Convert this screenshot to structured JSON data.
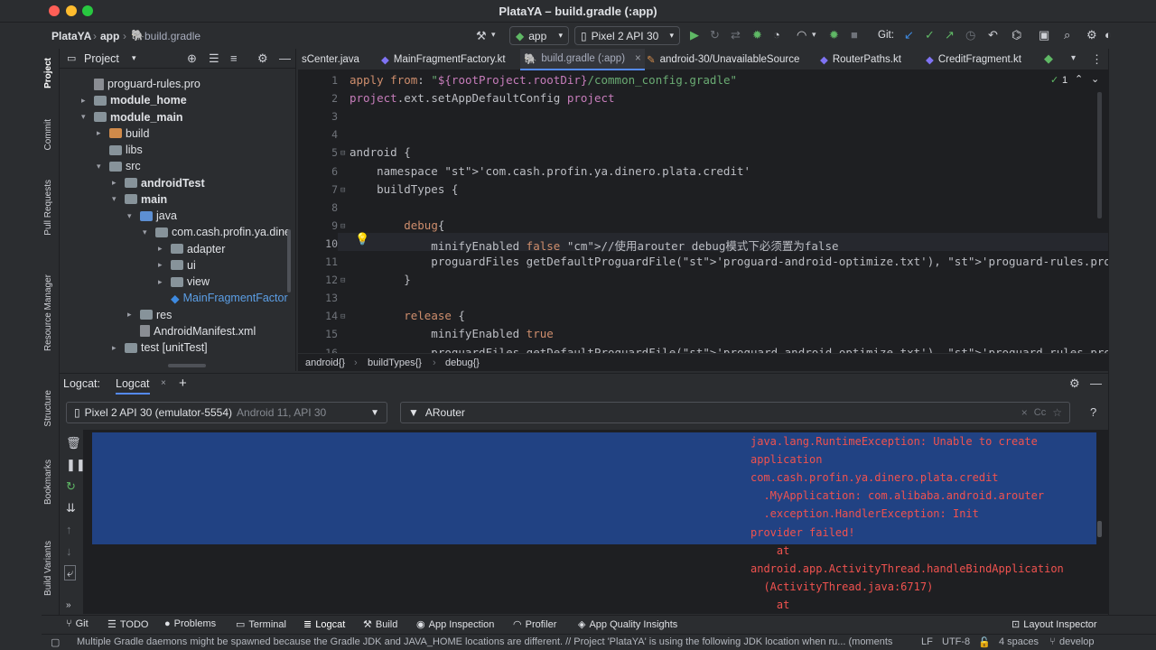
{
  "window": {
    "title": "PlataYA – build.gradle (:app)"
  },
  "nav": {
    "project": "PlataYA",
    "module": "app",
    "file": "build.gradle"
  },
  "toolbar": {
    "run_config": "app",
    "device": "Pixel 2 API 30",
    "git_label": "Git:"
  },
  "project_panel": {
    "title": "Project",
    "tree": [
      {
        "label": "proguard-rules.pro",
        "kind": "file",
        "indent": 0
      },
      {
        "label": "module_home",
        "kind": "folder",
        "indent": 0,
        "bold": true
      },
      {
        "label": "module_main",
        "kind": "folder",
        "indent": 0,
        "bold": true
      },
      {
        "label": "build",
        "kind": "folder-orange",
        "indent": 1
      },
      {
        "label": "libs",
        "kind": "folder",
        "indent": 1
      },
      {
        "label": "src",
        "kind": "folder",
        "indent": 1
      },
      {
        "label": "androidTest",
        "kind": "folder",
        "indent": 2,
        "bold": true
      },
      {
        "label": "main",
        "kind": "folder",
        "indent": 2,
        "bold": true
      },
      {
        "label": "java",
        "kind": "folder-blue",
        "indent": 3
      },
      {
        "label": "com.cash.profin.ya.dine",
        "kind": "folder",
        "indent": 4
      },
      {
        "label": "adapter",
        "kind": "folder",
        "indent": 5
      },
      {
        "label": "ui",
        "kind": "folder",
        "indent": 5
      },
      {
        "label": "view",
        "kind": "folder",
        "indent": 5
      },
      {
        "label": "MainFragmentFactor",
        "kind": "kotlin",
        "indent": 5
      },
      {
        "label": "res",
        "kind": "folder",
        "indent": 3
      },
      {
        "label": "AndroidManifest.xml",
        "kind": "file",
        "indent": 3
      },
      {
        "label": "test [unitTest]",
        "kind": "folder",
        "indent": 2
      }
    ]
  },
  "side_tools": [
    "Project",
    "Commit",
    "Pull Requests",
    "Resource Manager",
    "Structure",
    "Bookmarks",
    "Build Variants"
  ],
  "editor_tabs": [
    "sCenter.java",
    "MainFragmentFactory.kt",
    "build.gradle (:app)",
    "android-30/UnavailableSource",
    "RouterPaths.kt",
    "CreditFragment.kt"
  ],
  "editor": {
    "warnings": "1",
    "lines": [
      {
        "n": "1",
        "text": "apply from: \"${rootProject.rootDir}/common_config.gradle\""
      },
      {
        "n": "2",
        "text": "project.ext.setAppDefaultConfig project"
      },
      {
        "n": "3",
        "text": ""
      },
      {
        "n": "4",
        "text": ""
      },
      {
        "n": "5",
        "text": "android {"
      },
      {
        "n": "6",
        "text": "    namespace 'com.cash.profin.ya.dinero.plata.credit'"
      },
      {
        "n": "7",
        "text": "    buildTypes {"
      },
      {
        "n": "8",
        "text": ""
      },
      {
        "n": "9",
        "text": "        debug{"
      },
      {
        "n": "10",
        "text": "            minifyEnabled false //使用arouter debug模式下必须置为false"
      },
      {
        "n": "11",
        "text": "            proguardFiles getDefaultProguardFile('proguard-android-optimize.txt'), 'proguard-rules.pro'"
      },
      {
        "n": "12",
        "text": "        }"
      },
      {
        "n": "13",
        "text": ""
      },
      {
        "n": "14",
        "text": "        release {"
      },
      {
        "n": "15",
        "text": "            minifyEnabled true"
      },
      {
        "n": "16",
        "text": "            proguardFiles getDefaultProguardFile('proguard-android-optimize.txt'), 'proguard-rules.pro'"
      }
    ],
    "breadcrumb": [
      "android{}",
      "buildTypes{}",
      "debug{}"
    ]
  },
  "logcat": {
    "label": "Logcat:",
    "tab": "Logcat",
    "device": "Pixel 2 API 30 (emulator-5554)",
    "device_detail": "Android 11, API 30",
    "filter": "ARouter",
    "filter_opt": "Cc",
    "lines": [
      "java.lang.RuntimeException: Unable to create",
      "application",
      "com.cash.profin.ya.dinero.plata.credit",
      "  .MyApplication: com.alibaba.android.arouter",
      "  .exception.HandlerException: Init",
      "provider failed!",
      "    at",
      "android.app.ActivityThread.handleBindApplication",
      "  (ActivityThread.java:6717)",
      "    at"
    ]
  },
  "bottom_tabs": [
    "Git",
    "TODO",
    "Problems",
    "Terminal",
    "Logcat",
    "Build",
    "App Inspection",
    "Profiler",
    "App Quality Insights",
    "Layout Inspector"
  ],
  "status": {
    "message": "Multiple Gradle daemons might be spawned because the Gradle JDK and JAVA_HOME locations are different. // Project 'PlataYA' is using the following JDK location when ru... (moments ago)",
    "line_sep": "LF",
    "encoding": "UTF-8",
    "indent": "4 spaces",
    "branch": "develop"
  }
}
